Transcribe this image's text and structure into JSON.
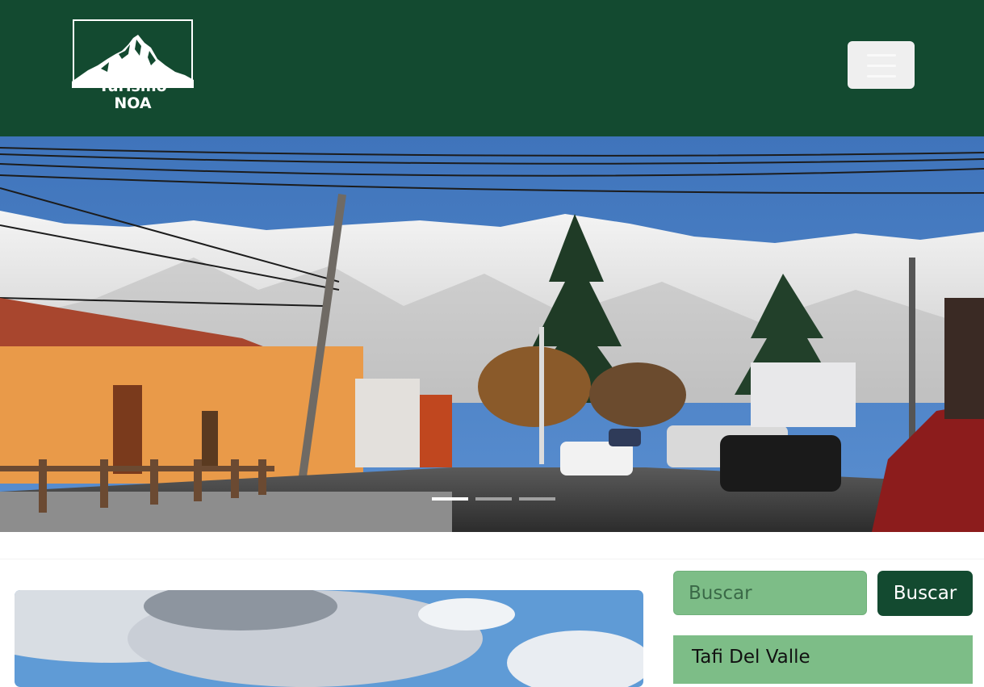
{
  "navbar": {
    "logo_line1": "Turismo",
    "logo_line2": "NOA",
    "menu_icon": "hamburger-icon",
    "background": "#134a30"
  },
  "carousel": {
    "slide_count": 3,
    "active_slide": 1
  },
  "search": {
    "placeholder": "Buscar",
    "button_label": "Buscar"
  },
  "sidebar": {
    "items": [
      {
        "label": "Tafi Del Valle"
      }
    ]
  },
  "colors": {
    "brand_dark": "#134a30",
    "accent_green": "#7dbd87"
  }
}
